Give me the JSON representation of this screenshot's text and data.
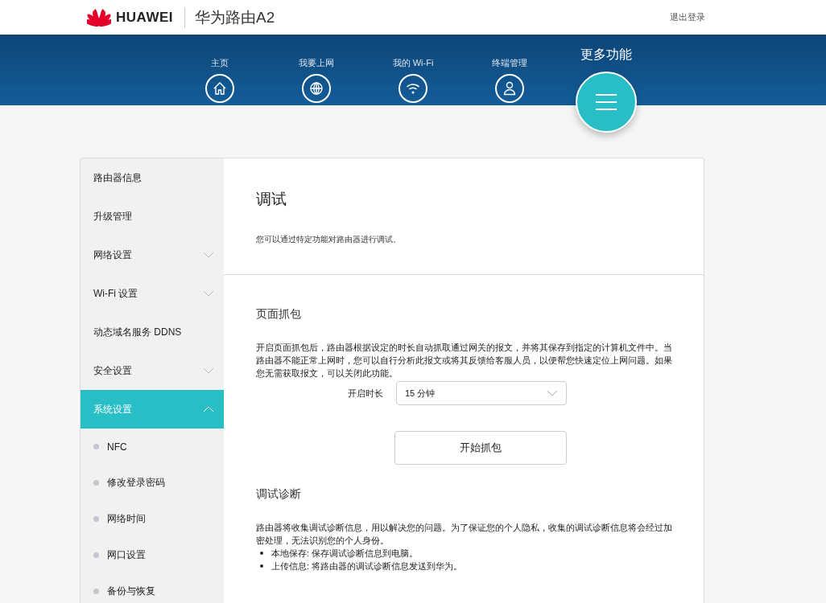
{
  "header": {
    "brand": "HUAWEI",
    "product": "华为路由A2",
    "logout": "退出登录"
  },
  "nav": [
    {
      "label": "主页",
      "kind": "home",
      "selected": false
    },
    {
      "label": "我要上网",
      "kind": "globe",
      "selected": false
    },
    {
      "label": "我的 Wi-Fi",
      "kind": "wifi",
      "selected": false
    },
    {
      "label": "终端管理",
      "kind": "user",
      "selected": false
    },
    {
      "label": "更多功能",
      "kind": "menu",
      "selected": true
    }
  ],
  "sidebar": {
    "items": [
      {
        "label": "路由器信息",
        "selected": false
      },
      {
        "label": "升级管理",
        "selected": false
      },
      {
        "label": "网络设置",
        "selected": false,
        "expanded": false
      },
      {
        "label": "Wi-Fi 设置",
        "selected": false,
        "expanded": false
      },
      {
        "label": "动态域名服务 DDNS",
        "selected": false
      },
      {
        "label": "安全设置",
        "selected": false,
        "expanded": false
      },
      {
        "label": "系统设置",
        "selected": true,
        "expanded": true,
        "children": [
          {
            "label": "NFC",
            "selected": false
          },
          {
            "label": "修改登录密码",
            "selected": false
          },
          {
            "label": "网络时间",
            "selected": false
          },
          {
            "label": "网口设置",
            "selected": false
          },
          {
            "label": "备份与恢复",
            "selected": false
          }
        ]
      }
    ]
  },
  "page": {
    "title": "调试",
    "subtitle": "您可以通过特定功能对路由器进行调试。"
  },
  "capture": {
    "title": "页面抓包",
    "description": "开启页面抓包后，路由器根据设定的时长自动抓取通过网关的报文，并将其保存到指定的计算机文件中。当路由器不能正常上网时，您可以自行分析此报文或将其反馈给客服人员，以便帮您快速定位上网问题。如果您无需获取报文，可以关闭此功能。",
    "duration_label": "开启时长",
    "duration_value": "15 分钟",
    "button": "开始抓包"
  },
  "diagnosis": {
    "title": "调试诊断",
    "description": "路由器将收集调试诊断信息，用以解决您的问题。为了保证您的个人隐私，收集的调试诊断信息将会经过加密处理，无法识别您的个人身份。",
    "bullets": [
      "本地保存: 保存调试诊断信息到电脑。",
      "上传信息: 将路由器的调试诊断信息发送到华为。"
    ]
  }
}
